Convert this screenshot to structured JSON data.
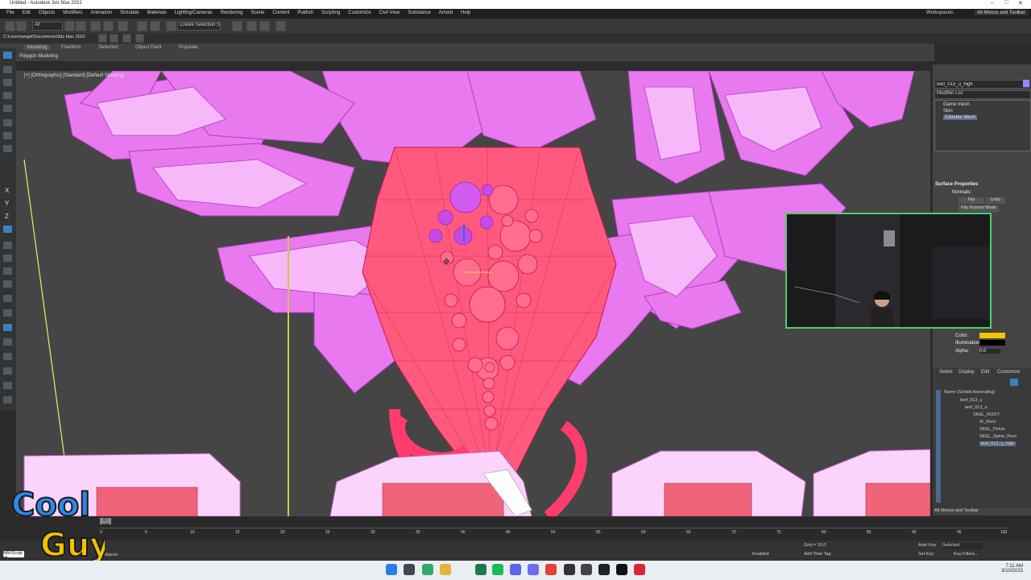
{
  "window": {
    "title": "Untitled - Autodesk 3ds Max 2022"
  },
  "menu": [
    "File",
    "Edit",
    "Objects",
    "Modifiers",
    "Animation",
    "Simulate",
    "Materials",
    "Lighting/Cameras",
    "Rendering",
    "Scene",
    "Content",
    "Publish",
    "Scripting",
    "Customize",
    "Civil View",
    "Substance",
    "Arnold",
    "Help"
  ],
  "workspaces": {
    "label": "Workspaces:",
    "value": "Alt Menus and Toolbar"
  },
  "toolbar": {
    "filter": "All",
    "selection_set": "Create Selection Se"
  },
  "path": "C:\\Users\\angel\\Documents\\3ds Max 2022",
  "ribbon": {
    "tabs": [
      "Modeling",
      "Freeform",
      "Selection",
      "Object Paint",
      "Populate"
    ],
    "sub": "Polygon Modeling"
  },
  "viewport": {
    "label": "[+] [Orthographic] [Standard] [Default Shading]"
  },
  "cmd_panel": {
    "object_name": "teef_013_u_high",
    "modifier_list": "Modifier List",
    "stack": [
      "Game mesh",
      "Skin",
      "Editable Mesh"
    ],
    "surface_properties": "Surface Properties",
    "normals": "Normals:",
    "flip": "Flip",
    "unify": "Unify",
    "flip_normal_mode": "Flip Normal Mode",
    "color": "Color:",
    "illumination": "Illumination:",
    "alpha": "Alpha:",
    "alpha_value": "0.0",
    "accent": "#f5c400"
  },
  "scene_explorer": {
    "tabs": [
      "Select",
      "Display",
      "Edit",
      "Customize"
    ],
    "header": "Name (Sorted Ascending)",
    "items": [
      "teef_013_u",
      "teef_013_u",
      "SKEL_ROOT",
      "IK_Root",
      "SKEL_Pelvis",
      "SKEL_Spine_Root",
      "teef_013_u_high"
    ]
  },
  "status": {
    "frame": "0 / 100",
    "grid": "Grid = 10.0",
    "add_time_tag": "Add Time Tag",
    "selected": "Selected",
    "auto_key": "Auto Key",
    "set_key": "Set Key",
    "key_filters": "Key Filters...",
    "alt_menu": "Alt Menus and Toolbar",
    "script": "MAXScript Mi",
    "hint": "ect objects",
    "enabled": "Enabled:"
  },
  "timeline_ticks": [
    "0",
    "5",
    "10",
    "15",
    "20",
    "25",
    "30",
    "35",
    "40",
    "45",
    "50",
    "55",
    "60",
    "65",
    "70",
    "75",
    "80",
    "85",
    "90",
    "95",
    "100"
  ],
  "clock": {
    "time": "7:11 AM",
    "date": "3/10/2023"
  },
  "logo": {
    "line1": "Cool",
    "line2": "Guy"
  }
}
